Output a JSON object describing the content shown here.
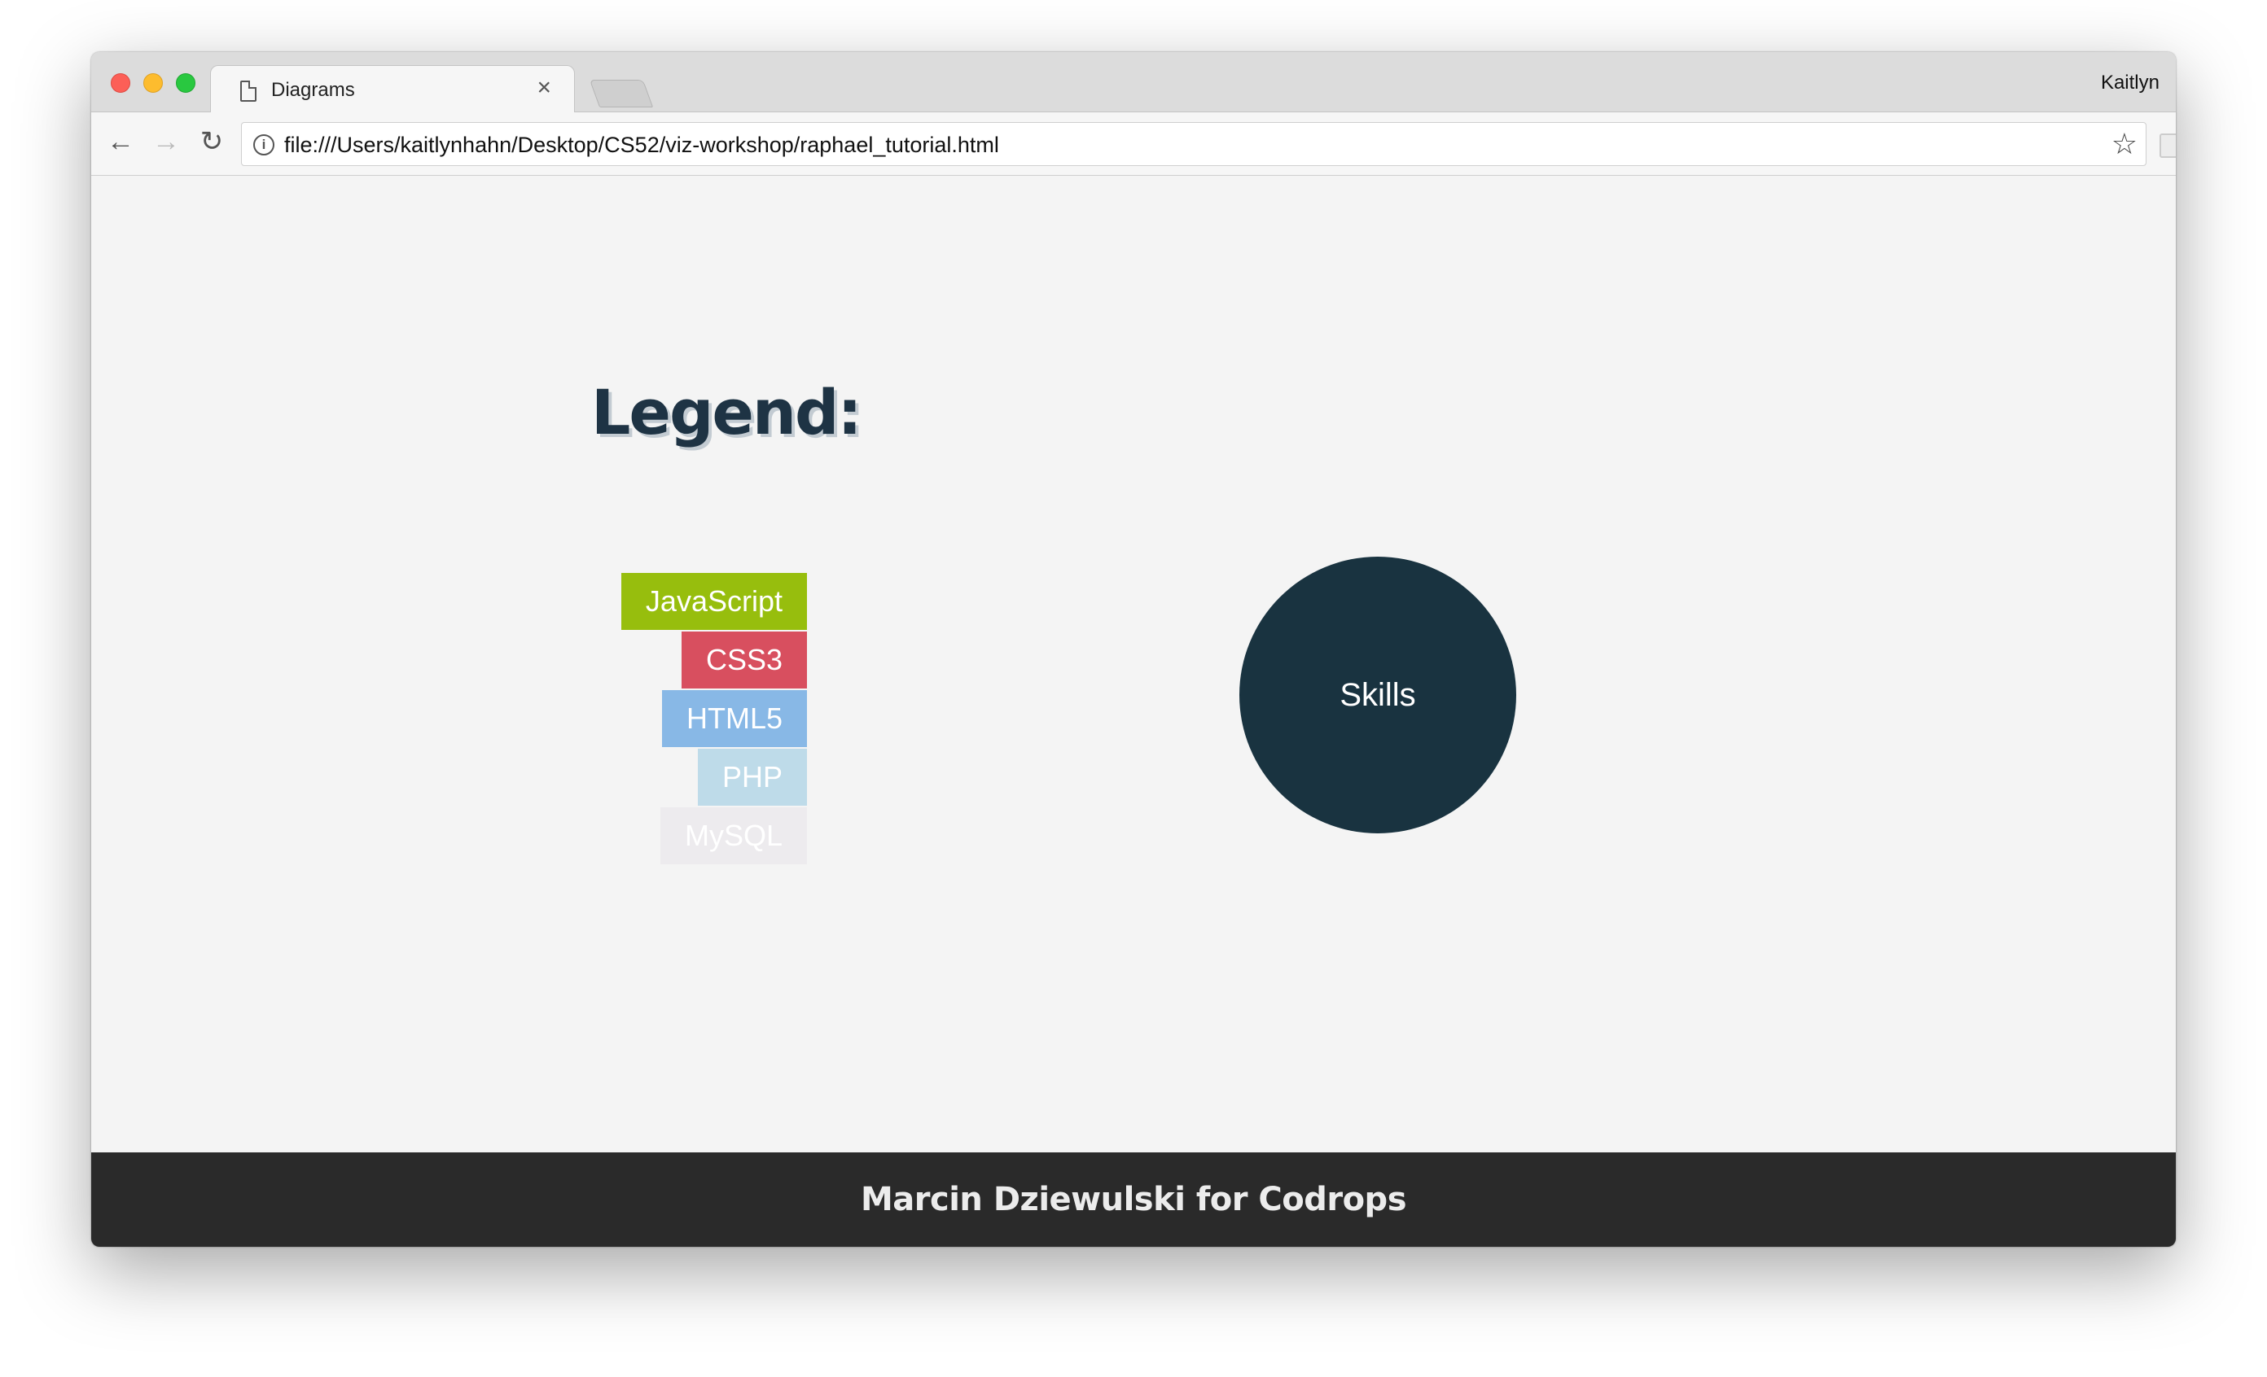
{
  "browser": {
    "tab_title": "Diagrams",
    "tab_close": "×",
    "profile_name": "Kaitlyn",
    "url": "file:///Users/kaitlynhahn/Desktop/CS52/viz-workshop/raphael_tutorial.html",
    "icons": {
      "back": "←",
      "forward": "→",
      "reload": "↻",
      "info": "i",
      "star": "☆",
      "menu": "⋮"
    }
  },
  "page": {
    "legend_title": "Legend:",
    "legend_items": [
      {
        "label": "JavaScript",
        "color": "#97be0d"
      },
      {
        "label": "CSS3",
        "color": "#d84f5f"
      },
      {
        "label": "HTML5",
        "color": "#88b8e6"
      },
      {
        "label": "PHP",
        "color": "#bedbe9"
      },
      {
        "label": "MySQL",
        "color": "#edebee"
      }
    ],
    "center_label": "Skills",
    "center_color": "#193340",
    "footer_text": "Marcin Dziewulski for Codrops"
  }
}
